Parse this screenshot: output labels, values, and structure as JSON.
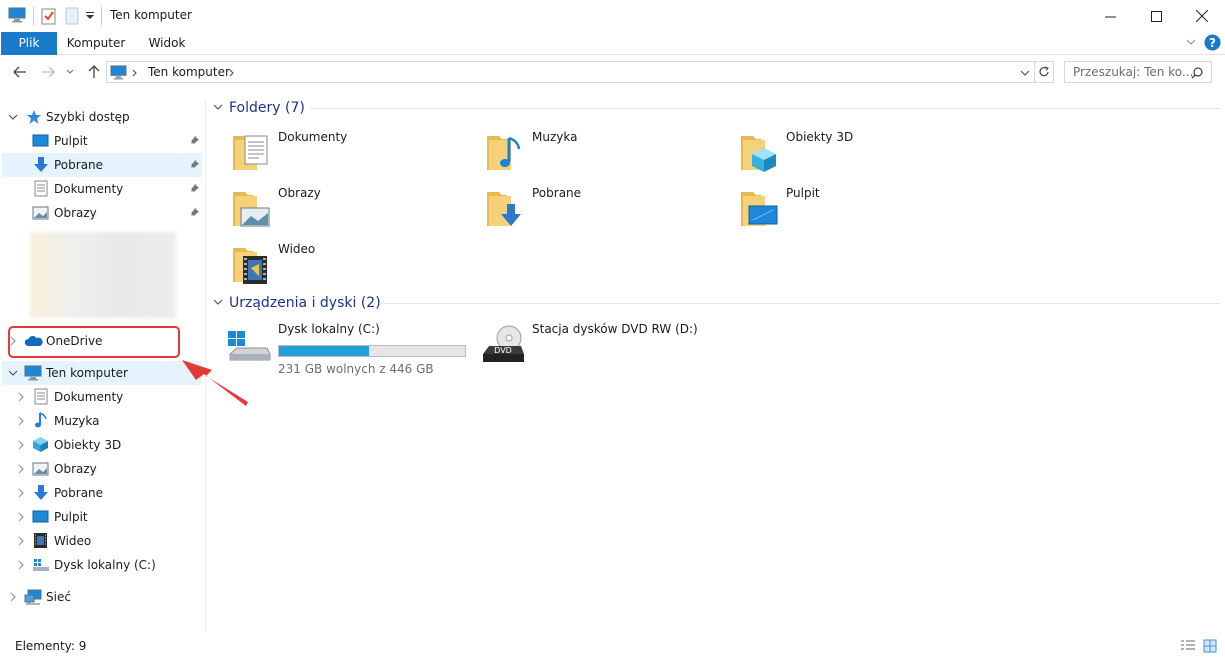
{
  "window": {
    "title": "Ten komputer",
    "buttons": {
      "minimize": "minimize-icon",
      "maximize": "maximize-icon",
      "close": "close-icon"
    }
  },
  "ribbon": {
    "tabs": [
      {
        "label": "Plik",
        "active": true,
        "color": "#1979ca"
      },
      {
        "label": "Komputer",
        "active": false
      },
      {
        "label": "Widok",
        "active": false
      }
    ]
  },
  "address": {
    "path": "Ten komputer",
    "search_placeholder": "Przeszukaj: Ten ko..."
  },
  "sidebar": {
    "quick_access": {
      "label": "Szybki dostęp",
      "items": [
        {
          "label": "Pulpit",
          "icon": "desktop-icon",
          "pinned": true
        },
        {
          "label": "Pobrane",
          "icon": "download-icon",
          "pinned": true,
          "selected": true
        },
        {
          "label": "Dokumenty",
          "icon": "document-icon",
          "pinned": true
        },
        {
          "label": "Obrazy",
          "icon": "picture-icon",
          "pinned": true
        }
      ]
    },
    "onedrive": {
      "label": "OneDrive",
      "icon": "cloud-icon"
    },
    "this_pc": {
      "label": "Ten komputer",
      "items": [
        {
          "label": "Dokumenty",
          "icon": "document-icon"
        },
        {
          "label": "Muzyka",
          "icon": "music-icon"
        },
        {
          "label": "Obiekty 3D",
          "icon": "cube-icon"
        },
        {
          "label": "Obrazy",
          "icon": "picture-icon"
        },
        {
          "label": "Pobrane",
          "icon": "download-icon"
        },
        {
          "label": "Pulpit",
          "icon": "desktop-icon"
        },
        {
          "label": "Wideo",
          "icon": "video-icon"
        },
        {
          "label": "Dysk lokalny (C:)",
          "icon": "drive-icon"
        }
      ]
    },
    "network": {
      "label": "Sieć",
      "icon": "network-icon"
    }
  },
  "main": {
    "folders_header": "Foldery (7)",
    "folders": [
      {
        "label": "Dokumenty",
        "icon": "document-folder-icon"
      },
      {
        "label": "Muzyka",
        "icon": "music-folder-icon"
      },
      {
        "label": "Obiekty 3D",
        "icon": "cube-folder-icon"
      },
      {
        "label": "Obrazy",
        "icon": "picture-folder-icon"
      },
      {
        "label": "Pobrane",
        "icon": "download-folder-icon"
      },
      {
        "label": "Pulpit",
        "icon": "desktop-folder-icon"
      },
      {
        "label": "Wideo",
        "icon": "video-folder-icon"
      }
    ],
    "devices_header": "Urządzenia i dyski (2)",
    "drives": [
      {
        "label": "Dysk lokalny (C:)",
        "free_text": "231 GB wolnych z 446 GB",
        "used_fraction": 0.482,
        "icon": "windows-drive-icon"
      },
      {
        "label": "Stacja dysków DVD RW (D:)",
        "icon": "dvd-drive-icon",
        "dvd_label": "DVD"
      }
    ]
  },
  "status": {
    "items": "Elementy: 9"
  },
  "annotation": {
    "highlight_color": "#e53935"
  }
}
